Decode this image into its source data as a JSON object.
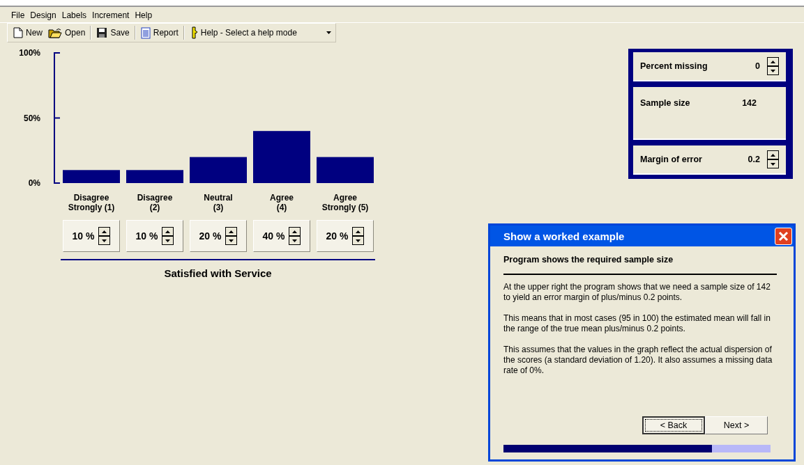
{
  "menu": [
    "File",
    "Design",
    "Labels",
    "Increment",
    "Help"
  ],
  "toolbar": [
    {
      "label": "New",
      "kind": "new"
    },
    {
      "label": "Open",
      "kind": "open"
    },
    {
      "label": "Save",
      "kind": "save"
    },
    {
      "label": "Report",
      "kind": "report"
    },
    {
      "label": "Help - Select a help mode",
      "kind": "help"
    }
  ],
  "chart_data": {
    "type": "bar",
    "categories": [
      "Disagree\nStrongly (1)",
      "Disagree\n(2)",
      "Neutral\n(3)",
      "Agree\n(4)",
      "Agree\nStrongly (5)"
    ],
    "values": [
      10,
      10,
      20,
      40,
      20
    ],
    "ylim": [
      0,
      100
    ],
    "yticks": [
      {
        "value": 0,
        "label": "0%"
      },
      {
        "value": 50,
        "label": "50%"
      },
      {
        "value": 100,
        "label": "100%"
      }
    ],
    "xlabel": "Satisfied with Service"
  },
  "spinners": [
    {
      "value": "10 %"
    },
    {
      "value": "10 %"
    },
    {
      "value": "20 %"
    },
    {
      "value": "40 %"
    },
    {
      "value": "20 %"
    }
  ],
  "settings": [
    {
      "label": "Percent missing",
      "value": "0",
      "kind": "spinner"
    },
    {
      "label": "Sample size",
      "value": "142",
      "kind": "readout"
    },
    {
      "label": "Margin of error",
      "value": "0.2",
      "kind": "spinner"
    }
  ],
  "dialog": {
    "title": "Show a worked example",
    "heading": "Program shows the required sample size",
    "paragraphs": [
      "At the upper right the program shows that we need a sample size of 142 to yield an error margin of plus/minus 0.2 points.",
      "This means that in most cases (95 in 100) the estimated mean will fall in the range of the true mean plus/minus 0.2 points.",
      "This assumes that the values in the graph reflect the actual dispersion of the scores (a standard deviation of  1.20).  It also assumes a missing data rate of 0%."
    ],
    "buttons": [
      {
        "label": "< Back",
        "focused": true
      },
      {
        "label": "Next >",
        "focused": false
      }
    ],
    "progress": {
      "level": 0.78
    }
  }
}
